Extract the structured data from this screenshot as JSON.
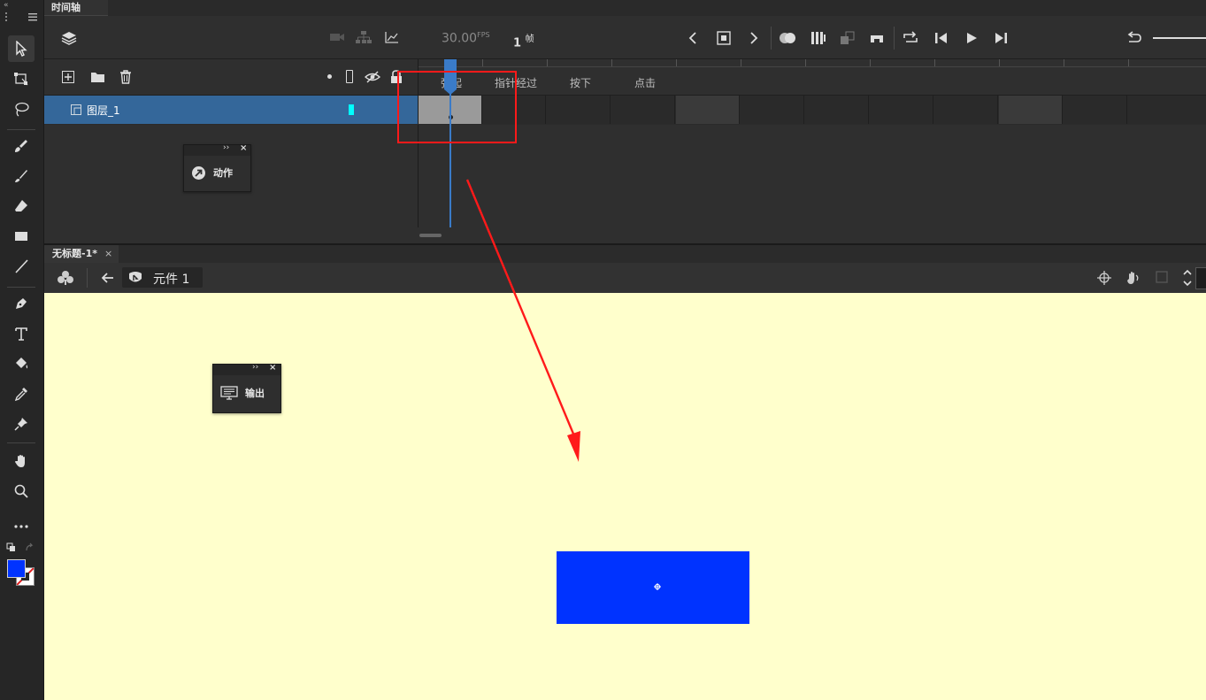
{
  "timeline": {
    "tab_label": "时间轴",
    "fps_value": "30.00",
    "fps_unit": "FPS",
    "frame_value": "1",
    "frame_unit": "帧",
    "frame_labels": [
      "弹起",
      "指针经过",
      "按下",
      "点击"
    ],
    "layer_name": "图层_1",
    "layer_color": "#00ffff"
  },
  "panels": {
    "actions_label": "动作",
    "output_label": "输出"
  },
  "document": {
    "tab_title": "无标题-1*",
    "symbol_name": "元件 1"
  },
  "colors": {
    "stage_bg": "#ffffcc",
    "fill": "#0033ff",
    "selection_row": "#34679a",
    "annotation": "#ff1a1a"
  }
}
